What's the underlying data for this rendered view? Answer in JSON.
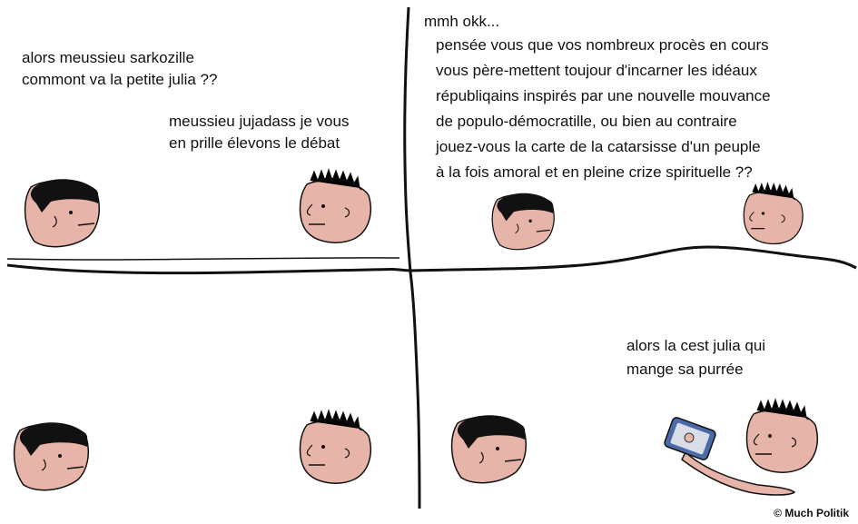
{
  "panels": [
    {
      "id": "panel-1",
      "lines_a": [
        "alors meussieu sarkozille",
        "commont va la petite julia ??"
      ],
      "lines_b": [
        "meussieu jujadass je vous",
        "en prille élevons le débat"
      ]
    },
    {
      "id": "panel-2",
      "lines_a": [
        "mmh okk..."
      ],
      "lines_b": [
        "pensée vous que vos nombreux procès en cours",
        "vous père-mettent  toujour d'incarner les idéaux",
        "républiqains inspirés par une nouvelle mouvance",
        "de populo-démocratille, ou bien au contraire",
        "jouez-vous la carte de la catarsisse d'un peuple",
        " à la  fois amoral et en pleine crize spirituelle ??"
      ]
    },
    {
      "id": "panel-3",
      "lines_a": [],
      "lines_b": []
    },
    {
      "id": "panel-4",
      "lines_a": [
        "alors la cest julia qui",
        "mange sa purrée"
      ],
      "lines_b": []
    }
  ],
  "copyright": "© Much Politik",
  "colors": {
    "skin": "#e6b4a8",
    "hair": "#111111",
    "ink": "#111111",
    "phone": "#4a6aa8"
  }
}
